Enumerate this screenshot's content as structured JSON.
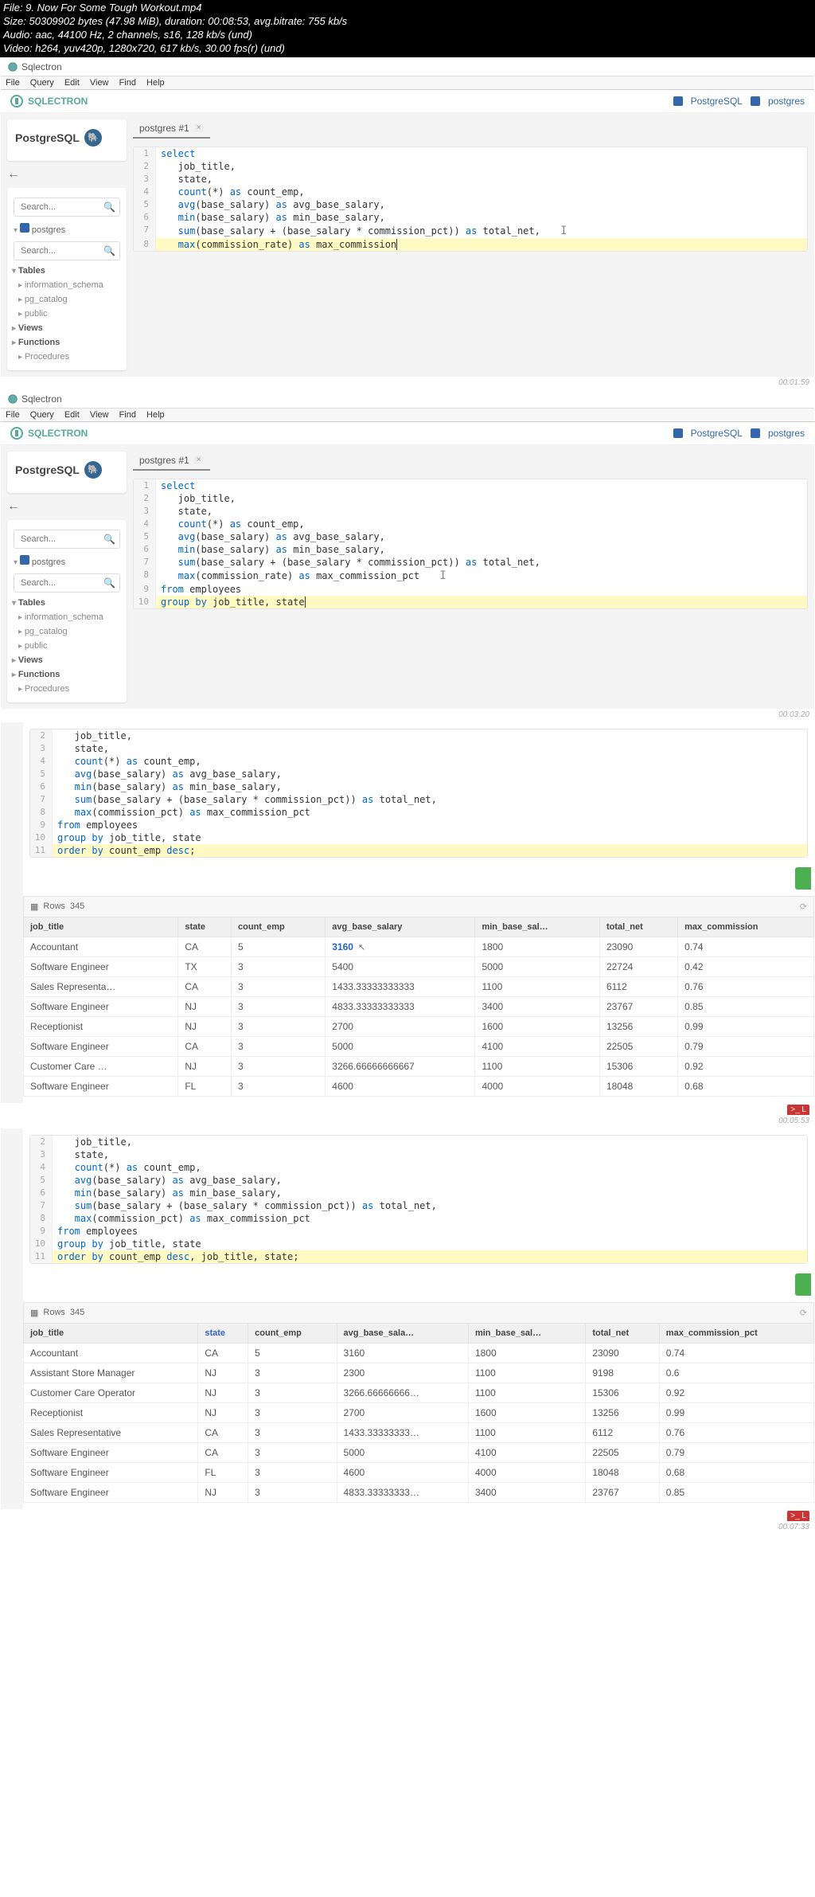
{
  "file_info": {
    "line1": "File: 9. Now For Some Tough Workout.mp4",
    "line2": "Size: 50309902 bytes (47.98 MiB), duration: 00:08:53, avg.bitrate: 755 kb/s",
    "line3": "Audio: aac, 44100 Hz, 2 channels, s16, 128 kb/s (und)",
    "line4": "Video: h264, yuv420p, 1280x720, 617 kb/s, 30.00 fps(r) (und)"
  },
  "app_title": "Sqlectron",
  "menu": {
    "file": "File",
    "query": "Query",
    "edit": "Edit",
    "view": "View",
    "find": "Find",
    "help": "Help"
  },
  "brand": "SQLECTRON",
  "db_label": "PostgreSQL",
  "db_user": "postgres",
  "sidebar": {
    "title": "PostgreSQL",
    "search_placeholder": "Search...",
    "db_node": "postgres",
    "tables": "Tables",
    "info_schema": "information_schema",
    "pg_catalog": "pg_catalog",
    "public": "public",
    "views": "Views",
    "functions": "Functions",
    "procedures": "Procedures"
  },
  "tab": {
    "label": "postgres #1"
  },
  "frame1": {
    "lines": [
      {
        "n": "1",
        "hl": false,
        "tokens": [
          [
            "kw",
            "select"
          ]
        ]
      },
      {
        "n": "2",
        "hl": false,
        "tokens": [
          [
            "ident",
            "   job_title,"
          ]
        ]
      },
      {
        "n": "3",
        "hl": false,
        "tokens": [
          [
            "ident",
            "   state,"
          ]
        ]
      },
      {
        "n": "4",
        "hl": false,
        "tokens": [
          [
            "fn",
            "   count"
          ],
          [
            "ident",
            "(*) "
          ],
          [
            "kw",
            "as"
          ],
          [
            "ident",
            " count_emp,"
          ]
        ]
      },
      {
        "n": "5",
        "hl": false,
        "tokens": [
          [
            "fn",
            "   avg"
          ],
          [
            "ident",
            "(base_salary) "
          ],
          [
            "kw",
            "as"
          ],
          [
            "ident",
            " avg_base_salary,"
          ]
        ]
      },
      {
        "n": "6",
        "hl": false,
        "tokens": [
          [
            "fn",
            "   min"
          ],
          [
            "ident",
            "(base_salary) "
          ],
          [
            "kw",
            "as"
          ],
          [
            "ident",
            " min_base_salary,"
          ]
        ]
      },
      {
        "n": "7",
        "hl": false,
        "tokens": [
          [
            "fn",
            "   sum"
          ],
          [
            "ident",
            "(base_salary + (base_salary * commission_pct)) "
          ],
          [
            "kw",
            "as"
          ],
          [
            "ident",
            " total_net,"
          ]
        ]
      },
      {
        "n": "8",
        "hl": true,
        "tokens": [
          [
            "fn",
            "   max"
          ],
          [
            "ident",
            "(commission_rate) "
          ],
          [
            "kw",
            "as"
          ],
          [
            "ident",
            " max_commission"
          ]
        ]
      }
    ],
    "cursor_after_line": "7",
    "timestamp": "00:01:59"
  },
  "frame2": {
    "lines": [
      {
        "n": "1",
        "hl": false,
        "tokens": [
          [
            "kw",
            "select"
          ]
        ]
      },
      {
        "n": "2",
        "hl": false,
        "tokens": [
          [
            "ident",
            "   job_title,"
          ]
        ]
      },
      {
        "n": "3",
        "hl": false,
        "tokens": [
          [
            "ident",
            "   state,"
          ]
        ]
      },
      {
        "n": "4",
        "hl": false,
        "tokens": [
          [
            "fn",
            "   count"
          ],
          [
            "ident",
            "(*) "
          ],
          [
            "kw",
            "as"
          ],
          [
            "ident",
            " count_emp,"
          ]
        ]
      },
      {
        "n": "5",
        "hl": false,
        "tokens": [
          [
            "fn",
            "   avg"
          ],
          [
            "ident",
            "(base_salary) "
          ],
          [
            "kw",
            "as"
          ],
          [
            "ident",
            " avg_base_salary,"
          ]
        ]
      },
      {
        "n": "6",
        "hl": false,
        "tokens": [
          [
            "fn",
            "   min"
          ],
          [
            "ident",
            "(base_salary) "
          ],
          [
            "kw",
            "as"
          ],
          [
            "ident",
            " min_base_salary,"
          ]
        ]
      },
      {
        "n": "7",
        "hl": false,
        "tokens": [
          [
            "fn",
            "   sum"
          ],
          [
            "ident",
            "(base_salary + (base_salary * commission_pct)) "
          ],
          [
            "kw",
            "as"
          ],
          [
            "ident",
            " total_net,"
          ]
        ]
      },
      {
        "n": "8",
        "hl": false,
        "tokens": [
          [
            "fn",
            "   max"
          ],
          [
            "ident",
            "(commission_rate) "
          ],
          [
            "kw",
            "as"
          ],
          [
            "ident",
            " max_commission_pct"
          ]
        ]
      },
      {
        "n": "9",
        "hl": false,
        "tokens": [
          [
            "kw",
            "from"
          ],
          [
            "ident",
            " employees"
          ]
        ]
      },
      {
        "n": "10",
        "hl": true,
        "tokens": [
          [
            "kw",
            "group by"
          ],
          [
            "ident",
            " job_title, state"
          ]
        ]
      }
    ],
    "cursor_after_line": "8",
    "timestamp": "00:03:20"
  },
  "frame3": {
    "lines": [
      {
        "n": "2",
        "hl": false,
        "tokens": [
          [
            "ident",
            "   job_title,"
          ]
        ]
      },
      {
        "n": "3",
        "hl": false,
        "tokens": [
          [
            "ident",
            "   state,"
          ]
        ]
      },
      {
        "n": "4",
        "hl": false,
        "tokens": [
          [
            "fn",
            "   count"
          ],
          [
            "ident",
            "(*) "
          ],
          [
            "kw",
            "as"
          ],
          [
            "ident",
            " count_emp,"
          ]
        ]
      },
      {
        "n": "5",
        "hl": false,
        "tokens": [
          [
            "fn",
            "   avg"
          ],
          [
            "ident",
            "(base_salary) "
          ],
          [
            "kw",
            "as"
          ],
          [
            "ident",
            " avg_base_salary,"
          ]
        ]
      },
      {
        "n": "6",
        "hl": false,
        "tokens": [
          [
            "fn",
            "   min"
          ],
          [
            "ident",
            "(base_salary) "
          ],
          [
            "kw",
            "as"
          ],
          [
            "ident",
            " min_base_salary,"
          ]
        ]
      },
      {
        "n": "7",
        "hl": false,
        "tokens": [
          [
            "fn",
            "   sum"
          ],
          [
            "ident",
            "(base_salary + (base_salary * commission_pct)) "
          ],
          [
            "kw",
            "as"
          ],
          [
            "ident",
            " total_net,"
          ]
        ]
      },
      {
        "n": "8",
        "hl": false,
        "tokens": [
          [
            "fn",
            "   max"
          ],
          [
            "ident",
            "(commission_pct) "
          ],
          [
            "kw",
            "as"
          ],
          [
            "ident",
            " max_commission_pct"
          ]
        ]
      },
      {
        "n": "9",
        "hl": false,
        "tokens": [
          [
            "kw",
            "from"
          ],
          [
            "ident",
            " employees"
          ]
        ]
      },
      {
        "n": "10",
        "hl": false,
        "tokens": [
          [
            "kw",
            "group by"
          ],
          [
            "ident",
            " job_title, state"
          ]
        ]
      },
      {
        "n": "11",
        "hl": true,
        "tokens": [
          [
            "kw",
            "order by"
          ],
          [
            "ident",
            " count_emp "
          ],
          [
            "kw",
            "desc"
          ],
          [
            "ident",
            ";"
          ]
        ]
      }
    ],
    "rows_label": "Rows",
    "rows_count": "345",
    "headers": [
      "job_title",
      "state",
      "count_emp",
      "avg_base_salary",
      "min_base_sal…",
      "total_net",
      "max_commission"
    ],
    "rows": [
      [
        "Accountant",
        "CA",
        "5",
        "3160",
        "1800",
        "23090",
        "0.74"
      ],
      [
        "Software Engineer",
        "TX",
        "3",
        "5400",
        "5000",
        "22724",
        "0.42"
      ],
      [
        "Sales Representa…",
        "CA",
        "3",
        "1433.33333333333",
        "1100",
        "6112",
        "0.76"
      ],
      [
        "Software Engineer",
        "NJ",
        "3",
        "4833.33333333333",
        "3400",
        "23767",
        "0.85"
      ],
      [
        "Receptionist",
        "NJ",
        "3",
        "2700",
        "1600",
        "13256",
        "0.99"
      ],
      [
        "Software Engineer",
        "CA",
        "3",
        "5000",
        "4100",
        "22505",
        "0.79"
      ],
      [
        "Customer Care …",
        "NJ",
        "3",
        "3266.66666666667",
        "1100",
        "15306",
        "0.92"
      ],
      [
        "Software Engineer",
        "FL",
        "3",
        "4600",
        "4000",
        "18048",
        "0.68"
      ]
    ],
    "hl_cell": "3160",
    "timestamp": "00:05:53",
    "red_tab": ">_ L"
  },
  "frame4": {
    "lines": [
      {
        "n": "2",
        "hl": false,
        "tokens": [
          [
            "ident",
            "   job_title,"
          ]
        ]
      },
      {
        "n": "3",
        "hl": false,
        "tokens": [
          [
            "ident",
            "   state,"
          ]
        ]
      },
      {
        "n": "4",
        "hl": false,
        "tokens": [
          [
            "fn",
            "   count"
          ],
          [
            "ident",
            "(*) "
          ],
          [
            "kw",
            "as"
          ],
          [
            "ident",
            " count_emp,"
          ]
        ]
      },
      {
        "n": "5",
        "hl": false,
        "tokens": [
          [
            "fn",
            "   avg"
          ],
          [
            "ident",
            "(base_salary) "
          ],
          [
            "kw",
            "as"
          ],
          [
            "ident",
            " avg_base_salary,"
          ]
        ]
      },
      {
        "n": "6",
        "hl": false,
        "tokens": [
          [
            "fn",
            "   min"
          ],
          [
            "ident",
            "(base_salary) "
          ],
          [
            "kw",
            "as"
          ],
          [
            "ident",
            " min_base_salary,"
          ]
        ]
      },
      {
        "n": "7",
        "hl": false,
        "tokens": [
          [
            "fn",
            "   sum"
          ],
          [
            "ident",
            "(base_salary + (base_salary * commission_pct)) "
          ],
          [
            "kw",
            "as"
          ],
          [
            "ident",
            " total_net,"
          ]
        ]
      },
      {
        "n": "8",
        "hl": false,
        "tokens": [
          [
            "fn",
            "   max"
          ],
          [
            "ident",
            "(commission_pct) "
          ],
          [
            "kw",
            "as"
          ],
          [
            "ident",
            " max_commission_pct"
          ]
        ]
      },
      {
        "n": "9",
        "hl": false,
        "tokens": [
          [
            "kw",
            "from"
          ],
          [
            "ident",
            " employees"
          ]
        ]
      },
      {
        "n": "10",
        "hl": false,
        "tokens": [
          [
            "kw",
            "group by"
          ],
          [
            "ident",
            " job_title, state"
          ]
        ]
      },
      {
        "n": "11",
        "hl": true,
        "tokens": [
          [
            "kw",
            "order by"
          ],
          [
            "ident",
            " count_emp "
          ],
          [
            "kw",
            "desc"
          ],
          [
            "ident",
            ", job_title, state;"
          ]
        ]
      }
    ],
    "rows_label": "Rows",
    "rows_count": "345",
    "headers": [
      "job_title",
      "state",
      "count_emp",
      "avg_base_sala…",
      "min_base_sal…",
      "total_net",
      "max_commission_pct"
    ],
    "sorted_col": "state",
    "rows": [
      [
        "Accountant",
        "CA",
        "5",
        "3160",
        "1800",
        "23090",
        "0.74"
      ],
      [
        "Assistant Store Manager",
        "NJ",
        "3",
        "2300",
        "1100",
        "9198",
        "0.6"
      ],
      [
        "Customer Care Operator",
        "NJ",
        "3",
        "3266.66666666…",
        "1100",
        "15306",
        "0.92"
      ],
      [
        "Receptionist",
        "NJ",
        "3",
        "2700",
        "1600",
        "13256",
        "0.99"
      ],
      [
        "Sales Representative",
        "CA",
        "3",
        "1433.33333333…",
        "1100",
        "6112",
        "0.76"
      ],
      [
        "Software Engineer",
        "CA",
        "3",
        "5000",
        "4100",
        "22505",
        "0.79"
      ],
      [
        "Software Engineer",
        "FL",
        "3",
        "4600",
        "4000",
        "18048",
        "0.68"
      ],
      [
        "Software Engineer",
        "NJ",
        "3",
        "4833.33333333…",
        "3400",
        "23767",
        "0.85"
      ]
    ],
    "timestamp": "00:07:33",
    "red_tab": ">_ L"
  }
}
